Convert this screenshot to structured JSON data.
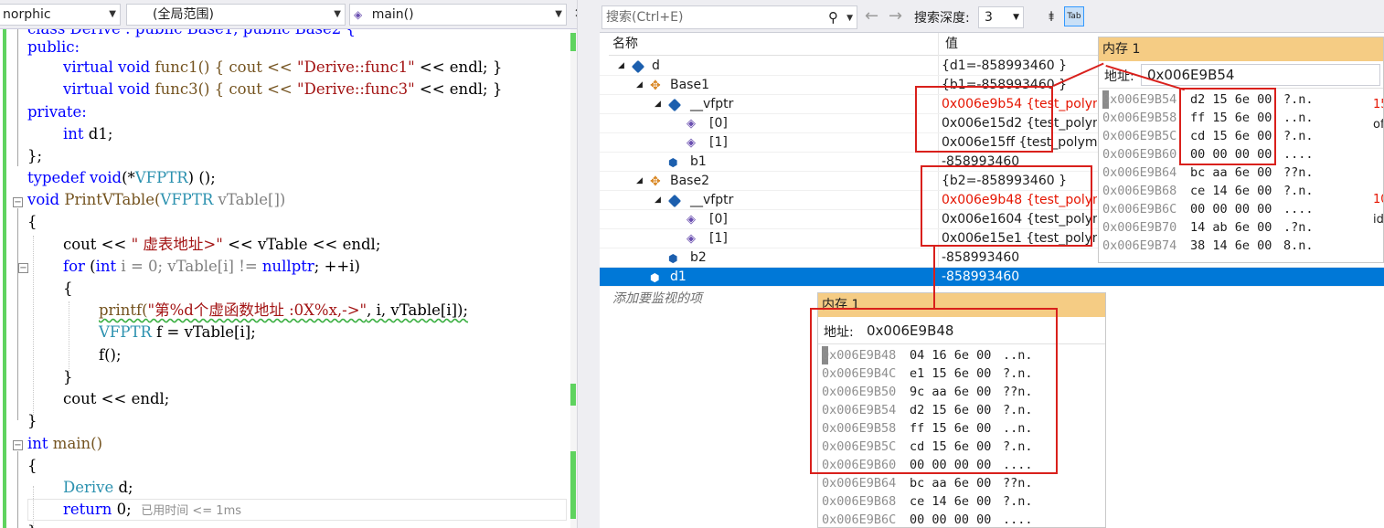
{
  "editor": {
    "nav": {
      "project": "norphic",
      "scope": "(全局范围)",
      "member": "main()"
    },
    "code": {
      "l0": "class Derive : public Base1, public Base2 {",
      "l1": "public:",
      "l2a": "virtual",
      "l2b": "void",
      "l2c": "func1() { cout << ",
      "l2d": "\"Derive::func1\"",
      "l2e": " << endl; }",
      "l3a": "virtual",
      "l3b": "void",
      "l3c": "func3() { cout << ",
      "l3d": "\"Derive::func3\"",
      "l3e": " << endl; }",
      "l4": "private:",
      "l5a": "int",
      "l5b": " d1;",
      "l6": "};",
      "l7a": "typedef",
      "l7b": " ",
      "l7c": "void",
      "l7d": "(*",
      "l7e": "VFPTR",
      "l7f": ") ();",
      "l8a": "void",
      "l8b": " PrintVTable(",
      "l8c": "VFPTR",
      "l8d": " vTable[])",
      "l9": "{",
      "l10a": "cout << ",
      "l10b": "\" 虚表地址>\"",
      "l10c": " << vTable << endl;",
      "l11a": "for",
      "l11b": " (",
      "l11c": "int",
      "l11d": " i = 0; vTable[i] != ",
      "l11e": "nullptr",
      "l11f": "; ++i)",
      "l12": "{",
      "l13a": "printf(",
      "l13b": "\"第%d个虚函数地址 :0X%x,->\"",
      "l13c": ", i, vTable[i]);",
      "l14a": "VFPTR",
      "l14b": " f = vTable[i];",
      "l15": "f();",
      "l16": "}",
      "l17": "cout << endl;",
      "l18": "}",
      "l19a": "int",
      "l19b": " main()",
      "l20": "{",
      "l21a": "Derive",
      "l21b": " d;",
      "l22a": "return",
      "l22b": " 0;",
      "elapsed": "已用时间 <= 1ms",
      "l23": "}"
    }
  },
  "watch": {
    "search_placeholder": "搜索(Ctrl+E)",
    "depth_label": "搜索深度:",
    "depth_value": "3",
    "col_name": "名称",
    "col_value": "值",
    "add_watch": "添加要监视的项",
    "rows": [
      {
        "name": "d",
        "value": "{d1=-858993460 }",
        "red": false
      },
      {
        "name": "Base1",
        "value": "{b1=-858993460 }",
        "red": false
      },
      {
        "name": "__vfptr",
        "value": "0x006e9b54 {test_polym",
        "red": true
      },
      {
        "name": "[0]",
        "value": "0x006e15d2 {test_polym",
        "red": false
      },
      {
        "name": "[1]",
        "value": "0x006e15ff {test_polymc",
        "red": false
      },
      {
        "name": "b1",
        "value": "-858993460",
        "red": false
      },
      {
        "name": "Base2",
        "value": "{b2=-858993460 }",
        "red": false
      },
      {
        "name": "__vfptr",
        "value": "0x006e9b48 {test_polym",
        "red": true
      },
      {
        "name": "[0]",
        "value": "0x006e1604 {test_polym",
        "red": false
      },
      {
        "name": "[1]",
        "value": "0x006e15e1 {test_polym",
        "red": false
      },
      {
        "name": "b2",
        "value": "-858993460",
        "red": false
      },
      {
        "name": "d1",
        "value": "-858993460",
        "red": false
      }
    ]
  },
  "memory1": {
    "title": "内存 1",
    "addr_label": "地址:",
    "addr_value": "0x006E9B54",
    "rows": [
      {
        "a": "0x006E9B54",
        "h": "d2 15 6e 00",
        "c": "?.n."
      },
      {
        "a": "0x006E9B58",
        "h": "ff 15 6e 00",
        "c": "..n."
      },
      {
        "a": "0x006E9B5C",
        "h": "cd 15 6e 00",
        "c": "?.n."
      },
      {
        "a": "0x006E9B60",
        "h": "00 00 00 00",
        "c": "...."
      },
      {
        "a": "0x006E9B64",
        "h": "bc aa 6e 00",
        "c": "??n."
      },
      {
        "a": "0x006E9B68",
        "h": "ce 14 6e 00",
        "c": "?.n."
      },
      {
        "a": "0x006E9B6C",
        "h": "00 00 00 00",
        "c": "...."
      },
      {
        "a": "0x006E9B70",
        "h": "14 ab 6e 00",
        "c": ".?n."
      },
      {
        "a": "0x006E9B74",
        "h": "38 14 6e 00",
        "c": "8.n."
      }
    ],
    "extras": [
      "15",
      "of",
      "10",
      "id"
    ]
  },
  "memory2": {
    "title": "内存 1",
    "addr_label": "地址:",
    "addr_value": "0x006E9B48",
    "rows": [
      {
        "a": "0x006E9B48",
        "h": "04 16 6e 00",
        "c": "..n."
      },
      {
        "a": "0x006E9B4C",
        "h": "e1 15 6e 00",
        "c": "?.n."
      },
      {
        "a": "0x006E9B50",
        "h": "9c aa 6e 00",
        "c": "??n."
      },
      {
        "a": "0x006E9B54",
        "h": "d2 15 6e 00",
        "c": "?.n."
      },
      {
        "a": "0x006E9B58",
        "h": "ff 15 6e 00",
        "c": "..n."
      },
      {
        "a": "0x006E9B5C",
        "h": "cd 15 6e 00",
        "c": "?.n."
      },
      {
        "a": "0x006E9B60",
        "h": "00 00 00 00",
        "c": "...."
      },
      {
        "a": "0x006E9B64",
        "h": "bc aa 6e 00",
        "c": "??n."
      },
      {
        "a": "0x006E9B68",
        "h": "ce 14 6e 00",
        "c": "?.n."
      },
      {
        "a": "0x006E9B6C",
        "h": "00 00 00 00",
        "c": "...."
      }
    ]
  }
}
